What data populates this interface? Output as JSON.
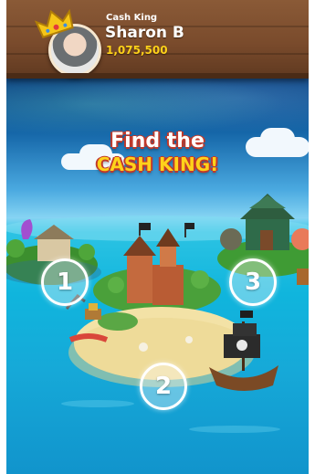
{
  "profile": {
    "label": "Cash King",
    "name": "Sharon B",
    "coins": "1,075,500"
  },
  "title": {
    "line1": "Find the",
    "line2": "CASH KING!"
  },
  "markers": [
    {
      "label": "1"
    },
    {
      "label": "2"
    },
    {
      "label": "3"
    }
  ],
  "icons": {
    "crown": "crown-icon",
    "avatar": "avatar-photo"
  },
  "colors": {
    "title_red": "#c0392b",
    "title_gold": "#ffd21a",
    "coins": "#ffd21a",
    "banner_wood": "#7a4b2c"
  }
}
